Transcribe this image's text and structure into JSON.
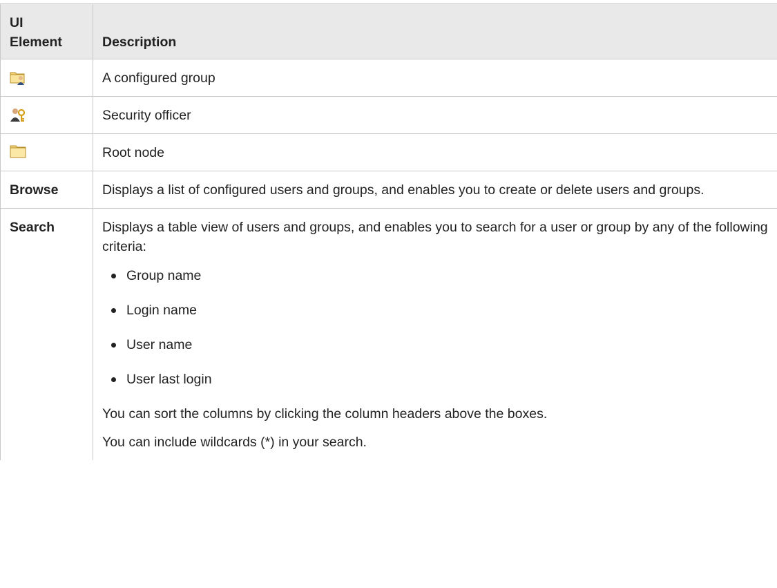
{
  "header": {
    "col1": "UI\nElement",
    "col1_line1": "UI",
    "col1_line2": "Element",
    "col2": "Description"
  },
  "rows": [
    {
      "icon": "configured-group-icon",
      "description": "A configured group"
    },
    {
      "icon": "security-officer-icon",
      "description": "Security officer"
    },
    {
      "icon": "root-node-folder-icon",
      "description": "Root node"
    },
    {
      "label": "Browse",
      "description": "Displays a list of configured users and groups, and enables you to create or delete users and groups."
    },
    {
      "label": "Search",
      "description": "Displays a table view of users and groups, and enables you to search for a user or group by any of the following criteria:",
      "criteria": [
        "Group name",
        "Login name",
        "User name",
        "User last login"
      ],
      "notes": [
        "You can sort the columns by clicking the column headers above the boxes.",
        "You can include wildcards (*) in your search."
      ]
    }
  ],
  "colors": {
    "header_bg": "#e9e9e9",
    "border": "#c8c8c8",
    "folder_yellow": "#f5d77a"
  }
}
